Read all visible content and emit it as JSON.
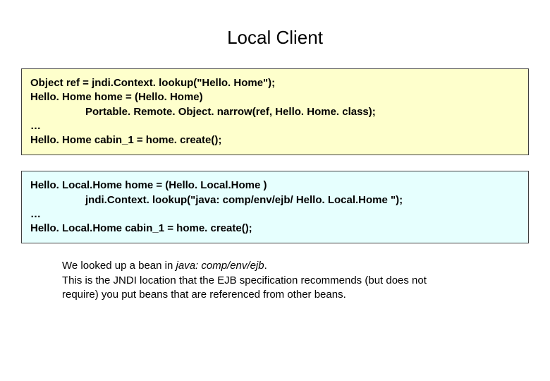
{
  "title": "Local Client",
  "code1": {
    "l1": "Object ref = jndi.Context. lookup(\"Hello. Home\");",
    "l2": "Hello. Home home = (Hello. Home)",
    "l3": "Portable. Remote. Object. narrow(ref, Hello. Home. class);",
    "l4": "…",
    "l5": "Hello. Home cabin_1 = home. create();"
  },
  "code2": {
    "l1a": "Hello. Local.Home",
    "l1b": " home = (",
    "l1c": "Hello. Local.Home",
    "l1d": " )",
    "l2a": "jndi.Context. lookup(\"java: comp/env/ejb/ ",
    "l2b": "Hello. Local.Home",
    "l2c": " \");",
    "l3": "…",
    "l4a": "Hello. Local.Home",
    "l4b": " cabin_1 = home. create();"
  },
  "note": {
    "l1a": "We looked up a bean in ",
    "l1b": "java: comp/env/ejb",
    "l1c": ".",
    "l2": "This is the JNDI location that the EJB specification recommends (but does not",
    "l3": "require) you put beans that are referenced from other beans."
  }
}
